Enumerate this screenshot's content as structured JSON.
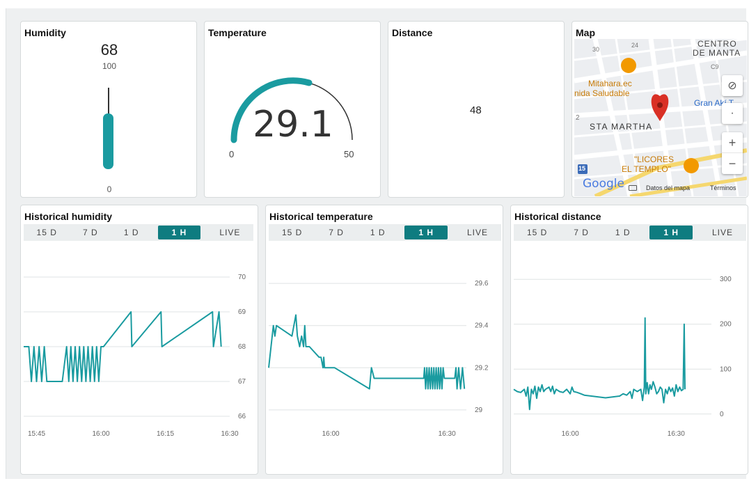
{
  "humidity": {
    "title": "Humidity",
    "value": "68",
    "max": "100",
    "min": "0",
    "level": 0.68
  },
  "temperature": {
    "title": "Temperature",
    "value": "29.1",
    "min": "0",
    "max": "50",
    "level": 0.582
  },
  "distance": {
    "title": "Distance",
    "value": "48"
  },
  "map": {
    "title": "Map",
    "labels": {
      "centro": "CENTRO",
      "de_manta": "DE MANTA",
      "mitahara": "Mitahara.ec",
      "saludable": "nida Saludable",
      "gran": "Gran Akí T",
      "sta_martha": "STA MARTHA",
      "licores": "\"LICORES",
      "templo": "EL TEMPLO\"",
      "road_15": "15",
      "street_24": "24",
      "street_30": "30",
      "street_2": "2",
      "street_c9": "C9"
    },
    "google": "Google",
    "map_data": "Datos del mapa",
    "terms": "Términos",
    "controls": {
      "zoom_in": "+",
      "zoom_out": "−"
    }
  },
  "time_tabs": [
    "15 D",
    "7 D",
    "1 D",
    "1 H",
    "LIVE"
  ],
  "active_tab": "1 H",
  "hist_humidity": {
    "title": "Historical humidity",
    "chart_data": {
      "type": "line",
      "y_ticks": [
        "70",
        "69",
        "68",
        "67",
        "66"
      ],
      "x_ticks": [
        "15:45",
        "16:00",
        "16:15",
        "16:30"
      ],
      "ylim": [
        66,
        70
      ],
      "xlim": [
        "15:42",
        "16:30"
      ],
      "series": [
        {
          "color": "#1a9ba0",
          "points": [
            [
              0,
              68
            ],
            [
              1.2,
              68
            ],
            [
              1.8,
              67
            ],
            [
              2.4,
              68
            ],
            [
              3,
              67
            ],
            [
              3.6,
              68
            ],
            [
              4.2,
              67
            ],
            [
              4.8,
              68
            ],
            [
              5.4,
              67
            ],
            [
              6,
              67
            ],
            [
              7,
              67
            ],
            [
              9,
              67
            ],
            [
              10,
              68
            ],
            [
              10.5,
              67
            ],
            [
              11,
              68
            ],
            [
              11.5,
              67
            ],
            [
              12,
              68
            ],
            [
              12.5,
              67
            ],
            [
              13,
              68
            ],
            [
              13.5,
              67
            ],
            [
              14,
              68
            ],
            [
              14.5,
              67
            ],
            [
              15,
              68
            ],
            [
              15.5,
              67
            ],
            [
              16,
              68
            ],
            [
              16.5,
              67
            ],
            [
              17,
              68
            ],
            [
              17.5,
              67
            ],
            [
              18,
              68
            ],
            [
              18.6,
              68
            ],
            [
              25,
              69
            ],
            [
              25.2,
              68
            ],
            [
              32,
              69
            ],
            [
              32.2,
              68
            ],
            [
              44,
              69
            ],
            [
              44.2,
              68
            ],
            [
              45.5,
              69
            ],
            [
              46,
              68
            ]
          ]
        }
      ]
    }
  },
  "hist_temperature": {
    "title": "Historical temperature",
    "chart_data": {
      "type": "line",
      "y_ticks": [
        "29.6",
        "29.4",
        "29.2",
        "29"
      ],
      "x_ticks": [
        "16:00",
        "16:30"
      ],
      "ylim": [
        28.97,
        29.63
      ],
      "xlim": [
        "15:44",
        "16:35"
      ],
      "series": [
        {
          "color": "#1a9ba0",
          "points": [
            [
              0,
              29.2
            ],
            [
              1.2,
              29.4
            ],
            [
              1.6,
              29.35
            ],
            [
              2,
              29.4
            ],
            [
              6,
              29.35
            ],
            [
              7,
              29.45
            ],
            [
              7.4,
              29.35
            ],
            [
              8,
              29.3
            ],
            [
              8.5,
              29.35
            ],
            [
              9,
              29.3
            ],
            [
              9.3,
              29.4
            ],
            [
              9.6,
              29.3
            ],
            [
              10.5,
              29.3
            ],
            [
              13,
              29.25
            ],
            [
              13.5,
              29.25
            ],
            [
              14,
              29.2
            ],
            [
              14.2,
              29.25
            ],
            [
              14.4,
              29.2
            ],
            [
              15,
              29.2
            ],
            [
              17,
              29.2
            ],
            [
              26,
              29.1
            ],
            [
              26.5,
              29.2
            ],
            [
              27.2,
              29.15
            ],
            [
              40,
              29.15
            ],
            [
              40.2,
              29.2
            ],
            [
              40.5,
              29.1
            ],
            [
              40.8,
              29.2
            ],
            [
              41.1,
              29.1
            ],
            [
              41.4,
              29.2
            ],
            [
              41.7,
              29.1
            ],
            [
              42,
              29.2
            ],
            [
              42.3,
              29.1
            ],
            [
              42.6,
              29.2
            ],
            [
              42.9,
              29.1
            ],
            [
              43.2,
              29.2
            ],
            [
              43.5,
              29.1
            ],
            [
              43.8,
              29.2
            ],
            [
              44.1,
              29.1
            ],
            [
              44.4,
              29.2
            ],
            [
              44.7,
              29.1
            ],
            [
              45,
              29.2
            ],
            [
              45.3,
              29.15
            ],
            [
              48,
              29.15
            ],
            [
              48.3,
              29.2
            ],
            [
              48.6,
              29.1
            ],
            [
              49,
              29.2
            ],
            [
              49.5,
              29.1
            ],
            [
              50,
              29.2
            ],
            [
              50.5,
              29.1
            ]
          ]
        }
      ]
    }
  },
  "hist_distance": {
    "title": "Historical distance",
    "chart_data": {
      "type": "line",
      "y_ticks": [
        "300",
        "200",
        "100",
        "0"
      ],
      "x_ticks": [
        "16:00",
        "16:30"
      ],
      "ylim": [
        -5,
        305
      ],
      "xlim": [
        "15:44",
        "16:40"
      ],
      "series": [
        {
          "color": "#1a9ba0",
          "points": [
            [
              0,
              55
            ],
            [
              1,
              50
            ],
            [
              2,
              48
            ],
            [
              3,
              55
            ],
            [
              3.5,
              40
            ],
            [
              4,
              60
            ],
            [
              4.5,
              10
            ],
            [
              5,
              55
            ],
            [
              5.5,
              45
            ],
            [
              6,
              62
            ],
            [
              6.5,
              35
            ],
            [
              7,
              60
            ],
            [
              7.5,
              50
            ],
            [
              8,
              65
            ],
            [
              8.5,
              50
            ],
            [
              9,
              55
            ],
            [
              10,
              60
            ],
            [
              10.5,
              50
            ],
            [
              11,
              62
            ],
            [
              11.5,
              45
            ],
            [
              12,
              55
            ],
            [
              13,
              50
            ],
            [
              14,
              48
            ],
            [
              15,
              55
            ],
            [
              16,
              45
            ],
            [
              16.5,
              60
            ],
            [
              17,
              50
            ],
            [
              18,
              48
            ],
            [
              19,
              45
            ],
            [
              20,
              42
            ],
            [
              22,
              40
            ],
            [
              24,
              38
            ],
            [
              26,
              36
            ],
            [
              28,
              38
            ],
            [
              30,
              40
            ],
            [
              31,
              45
            ],
            [
              32,
              42
            ],
            [
              33,
              50
            ],
            [
              33.5,
              35
            ],
            [
              34,
              55
            ],
            [
              35,
              50
            ],
            [
              36,
              55
            ],
            [
              36.5,
              30
            ],
            [
              37,
              60
            ],
            [
              37.2,
              214
            ],
            [
              37.4,
              45
            ],
            [
              37.8,
              70
            ],
            [
              38.2,
              45
            ],
            [
              38.6,
              65
            ],
            [
              39,
              55
            ],
            [
              39.5,
              72
            ],
            [
              40,
              60
            ],
            [
              40.5,
              45
            ],
            [
              41,
              50
            ],
            [
              41.5,
              60
            ],
            [
              42,
              55
            ],
            [
              42.5,
              25
            ],
            [
              43,
              55
            ],
            [
              43.5,
              45
            ],
            [
              44,
              60
            ],
            [
              44.5,
              50
            ],
            [
              45,
              58
            ],
            [
              45.5,
              40
            ],
            [
              46,
              65
            ],
            [
              46.5,
              50
            ],
            [
              47,
              60
            ],
            [
              47.5,
              52
            ],
            [
              48,
              55
            ],
            [
              48.3,
              200
            ],
            [
              48.5,
              55
            ]
          ]
        }
      ]
    }
  }
}
